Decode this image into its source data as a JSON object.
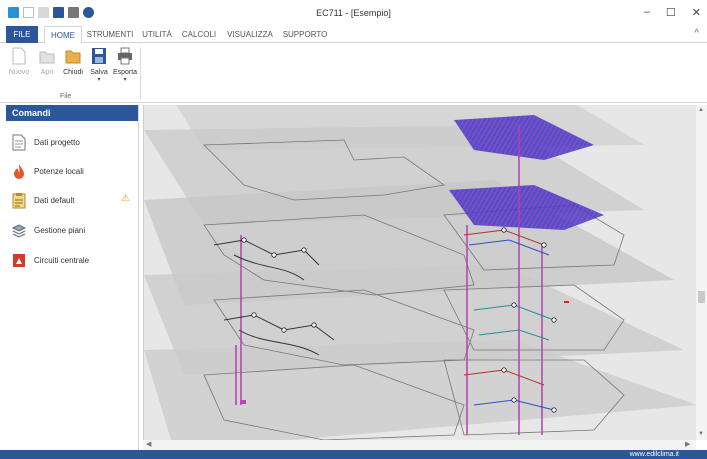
{
  "window": {
    "title": "EC711 - [Esempio]",
    "controls": [
      "–",
      "☐",
      "✕"
    ]
  },
  "tabs": [
    {
      "label": "FILE"
    },
    {
      "label": "HOME"
    },
    {
      "label": "STRUMENTI"
    },
    {
      "label": "UTILITÀ"
    },
    {
      "label": "CALCOLI"
    },
    {
      "label": "VISUALIZZA"
    },
    {
      "label": "SUPPORTO"
    }
  ],
  "ribbon": {
    "group_label": "File",
    "buttons": [
      {
        "label": "Nuovo",
        "enabled": false
      },
      {
        "label": "Apri",
        "enabled": false
      },
      {
        "label": "Chiudi",
        "enabled": true
      },
      {
        "label": "Salva",
        "enabled": true
      },
      {
        "label": "Esporta",
        "enabled": true
      }
    ]
  },
  "panel": {
    "header": "Comandi",
    "commands": [
      {
        "label": "Dati progetto"
      },
      {
        "label": "Potenze locali"
      },
      {
        "label": "Dati default"
      },
      {
        "label": "Gestione piani"
      },
      {
        "label": "Circuiti centrale"
      }
    ]
  },
  "status": {
    "website": "www.edilclima.it"
  },
  "colors": {
    "accent": "#2b579a",
    "warning": "#e0a020",
    "pipe_red": "#c02a2a",
    "pipe_blue": "#2a4fc0",
    "riser": "#b040b0"
  }
}
